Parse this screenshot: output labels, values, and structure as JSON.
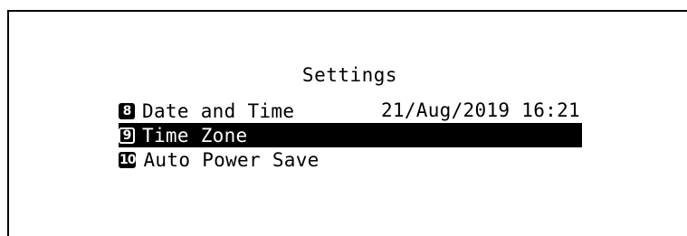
{
  "screen": {
    "title": "Settings"
  },
  "menu": {
    "items": [
      {
        "number": "8",
        "label": "Date and Time",
        "value": "21/Aug/2019 16:21",
        "selected": false
      },
      {
        "number": "9",
        "label": "Time Zone",
        "value": "",
        "selected": true
      },
      {
        "number": "10",
        "label": "Auto Power Save",
        "value": "",
        "selected": false
      }
    ]
  },
  "colors": {
    "background": "#ffffff",
    "foreground": "#000000",
    "highlight": "#000000",
    "highlight_text": "#ffffff"
  }
}
